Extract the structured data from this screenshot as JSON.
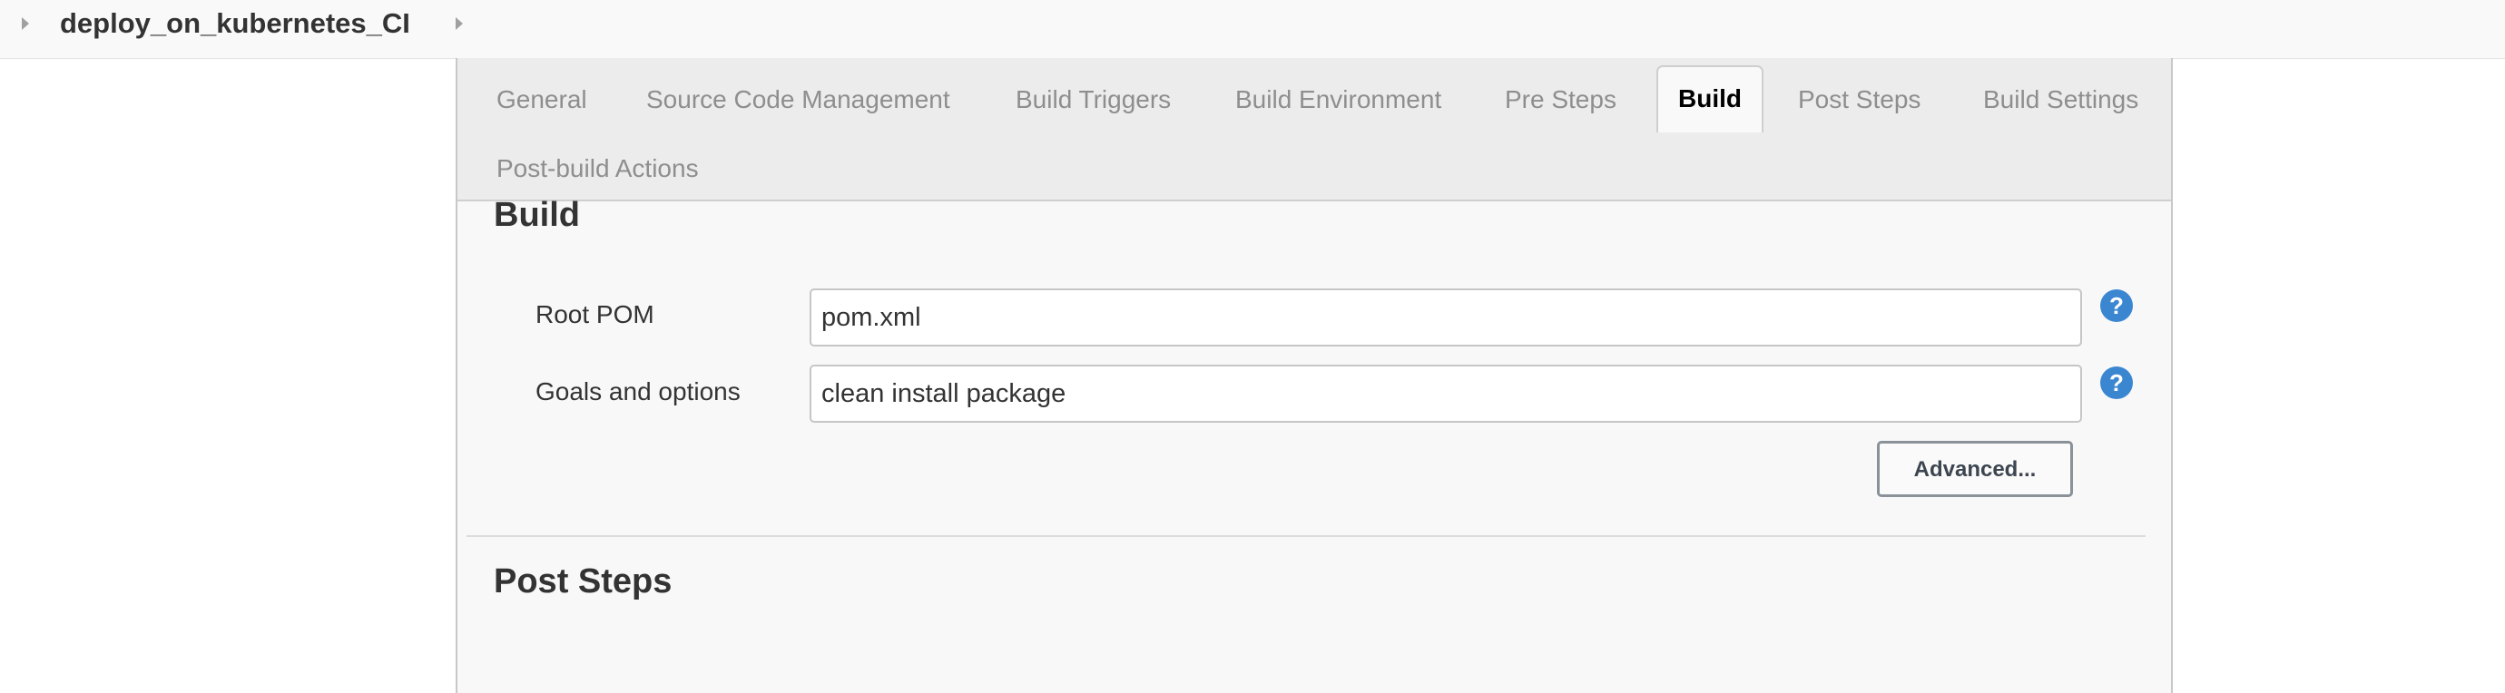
{
  "breadcrumb": {
    "job_name": "deploy_on_kubernetes_CI"
  },
  "tabs": [
    {
      "label": "General",
      "active": false
    },
    {
      "label": "Source Code Management",
      "active": false
    },
    {
      "label": "Build Triggers",
      "active": false
    },
    {
      "label": "Build Environment",
      "active": false
    },
    {
      "label": "Pre Steps",
      "active": false
    },
    {
      "label": "Build",
      "active": true
    },
    {
      "label": "Post Steps",
      "active": false
    },
    {
      "label": "Build Settings",
      "active": false
    },
    {
      "label": "Post-build Actions",
      "active": false
    }
  ],
  "build_section": {
    "title": "Build",
    "root_pom_label": "Root POM",
    "root_pom_value": "pom.xml",
    "goals_label": "Goals and options",
    "goals_value": "clean install package",
    "help_glyph": "?",
    "advanced_label": "Advanced..."
  },
  "post_steps_section": {
    "title": "Post Steps"
  },
  "colors": {
    "help_icon": "#3a86d1",
    "tabbar_bg": "#ececec",
    "panel_bg": "#f8f8f8"
  },
  "icons": {
    "breadcrumb_arrow": "caret-right-icon",
    "help": "help-icon"
  }
}
